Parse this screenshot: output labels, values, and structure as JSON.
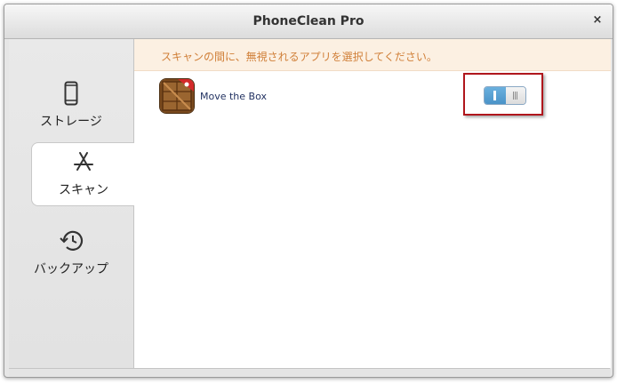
{
  "window": {
    "title": "PhoneClean Pro",
    "close_symbol": "×"
  },
  "sidebar": {
    "items": [
      {
        "label": "ストレージ",
        "icon": "phone-icon",
        "selected": false
      },
      {
        "label": "スキャン",
        "icon": "app-store-icon",
        "selected": true
      },
      {
        "label": "バックアップ",
        "icon": "history-icon",
        "selected": false
      }
    ]
  },
  "notice": {
    "text": "スキャンの間に、無視されるアプリを選択してください。"
  },
  "apps": [
    {
      "name": "Move the Box",
      "icon": "move-the-box-app-icon",
      "toggle_on": true
    }
  ],
  "colors": {
    "notice_text": "#d07f38",
    "notice_bg": "#fcf0e2",
    "toggle_on": "#4a93c8",
    "highlight": "#b0161c",
    "app_name": "#1f2f5f"
  }
}
